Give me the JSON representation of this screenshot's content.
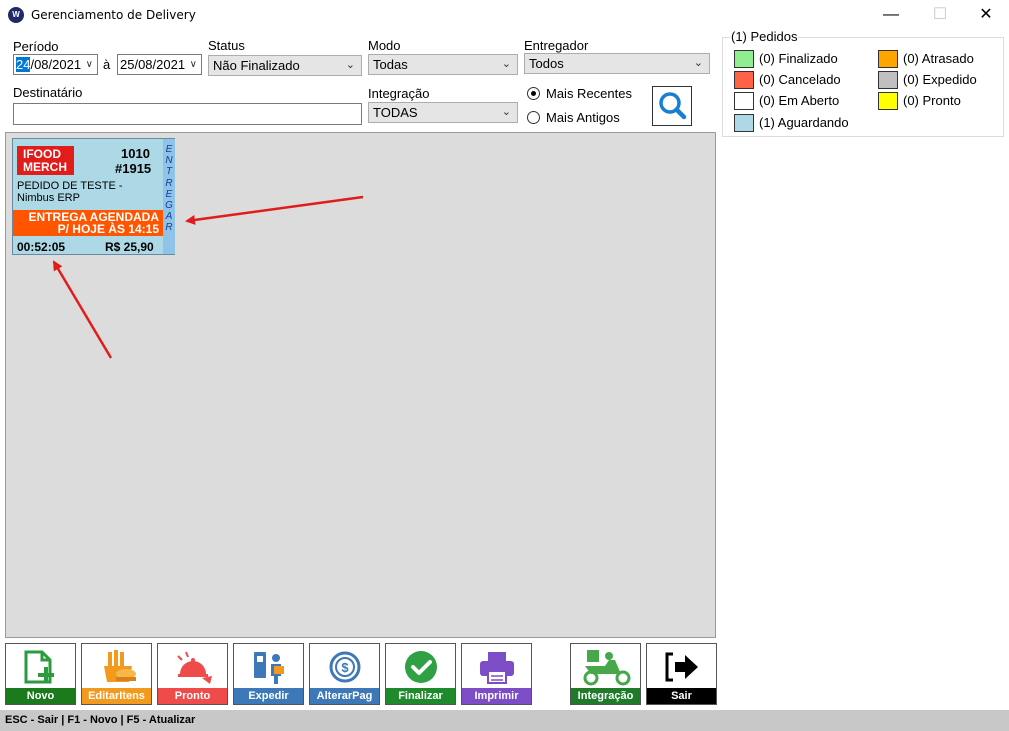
{
  "window": {
    "title": "Gerenciamento de Delivery",
    "minimize": "—",
    "maximize": "☐",
    "close": "✕"
  },
  "filters": {
    "periodo_label": "Período",
    "date_from_sel": "24",
    "date_from_rest": "/08/2021",
    "date_sep": "à",
    "date_to": "25/08/2021",
    "status_label": "Status",
    "status_value": "Não Finalizado",
    "modo_label": "Modo",
    "modo_value": "Todas",
    "entregador_label": "Entregador",
    "entregador_value": "Todos",
    "destinatario_label": "Destinatário",
    "destinatario_value": "",
    "integracao_label": "Integração",
    "integracao_value": "TODAS",
    "radio_recent": "Mais Recentes",
    "radio_old": "Mais Antigos",
    "selected_order": "Mais Recentes"
  },
  "legend": {
    "title": "(1) Pedidos",
    "items": [
      {
        "label": "(0) Finalizado",
        "color": "#90ee90"
      },
      {
        "label": "(0) Atrasado",
        "color": "#ffa500"
      },
      {
        "label": "(0) Cancelado",
        "color": "#ff6347"
      },
      {
        "label": "(0) Expedido",
        "color": "#c0c0c0"
      },
      {
        "label": "(0) Em Aberto",
        "color": "#ffffff"
      },
      {
        "label": "(0) Pronto",
        "color": "#ffff00"
      },
      {
        "label": "(1) Aguardando",
        "color": "#add8e6"
      }
    ]
  },
  "order": {
    "badge_line1": "IFOOD",
    "badge_line2": "MERCH",
    "number": "1010",
    "code": "#1915",
    "description": "PEDIDO DE TESTE - Nimbus ERP",
    "sched_line1": "ENTREGA AGENDADA",
    "sched_line2": "P/ HOJE ÀS 14:15",
    "elapsed": "00:52:05",
    "price": "R$ 25,90",
    "vertical_label": "ENTREGAR",
    "card_color": "#add8e6"
  },
  "toolbar": [
    {
      "label": "Novo",
      "color": "#1b7a1b",
      "icon": "new-document-icon"
    },
    {
      "label": "EditarItens",
      "color": "#f39a1e",
      "icon": "food-icon"
    },
    {
      "label": "Pronto",
      "color": "#ef4b4b",
      "icon": "bell-icon"
    },
    {
      "label": "Expedir",
      "color": "#3d78b8",
      "icon": "delivery-person-icon"
    },
    {
      "label": "AlterarPag",
      "color": "#3d78b8",
      "icon": "payment-icon"
    },
    {
      "label": "Finalizar",
      "color": "#1f8a2c",
      "icon": "check-icon"
    },
    {
      "label": "Imprimir",
      "color": "#7d4cc7",
      "icon": "printer-icon"
    },
    {
      "label": "Integração",
      "color": "#1f7a2a",
      "icon": "scooter-icon"
    },
    {
      "label": "Sair",
      "color": "#000000",
      "icon": "exit-icon"
    }
  ],
  "statusbar": "ESC - Sair | F1 - Novo | F5 - Atualizar"
}
